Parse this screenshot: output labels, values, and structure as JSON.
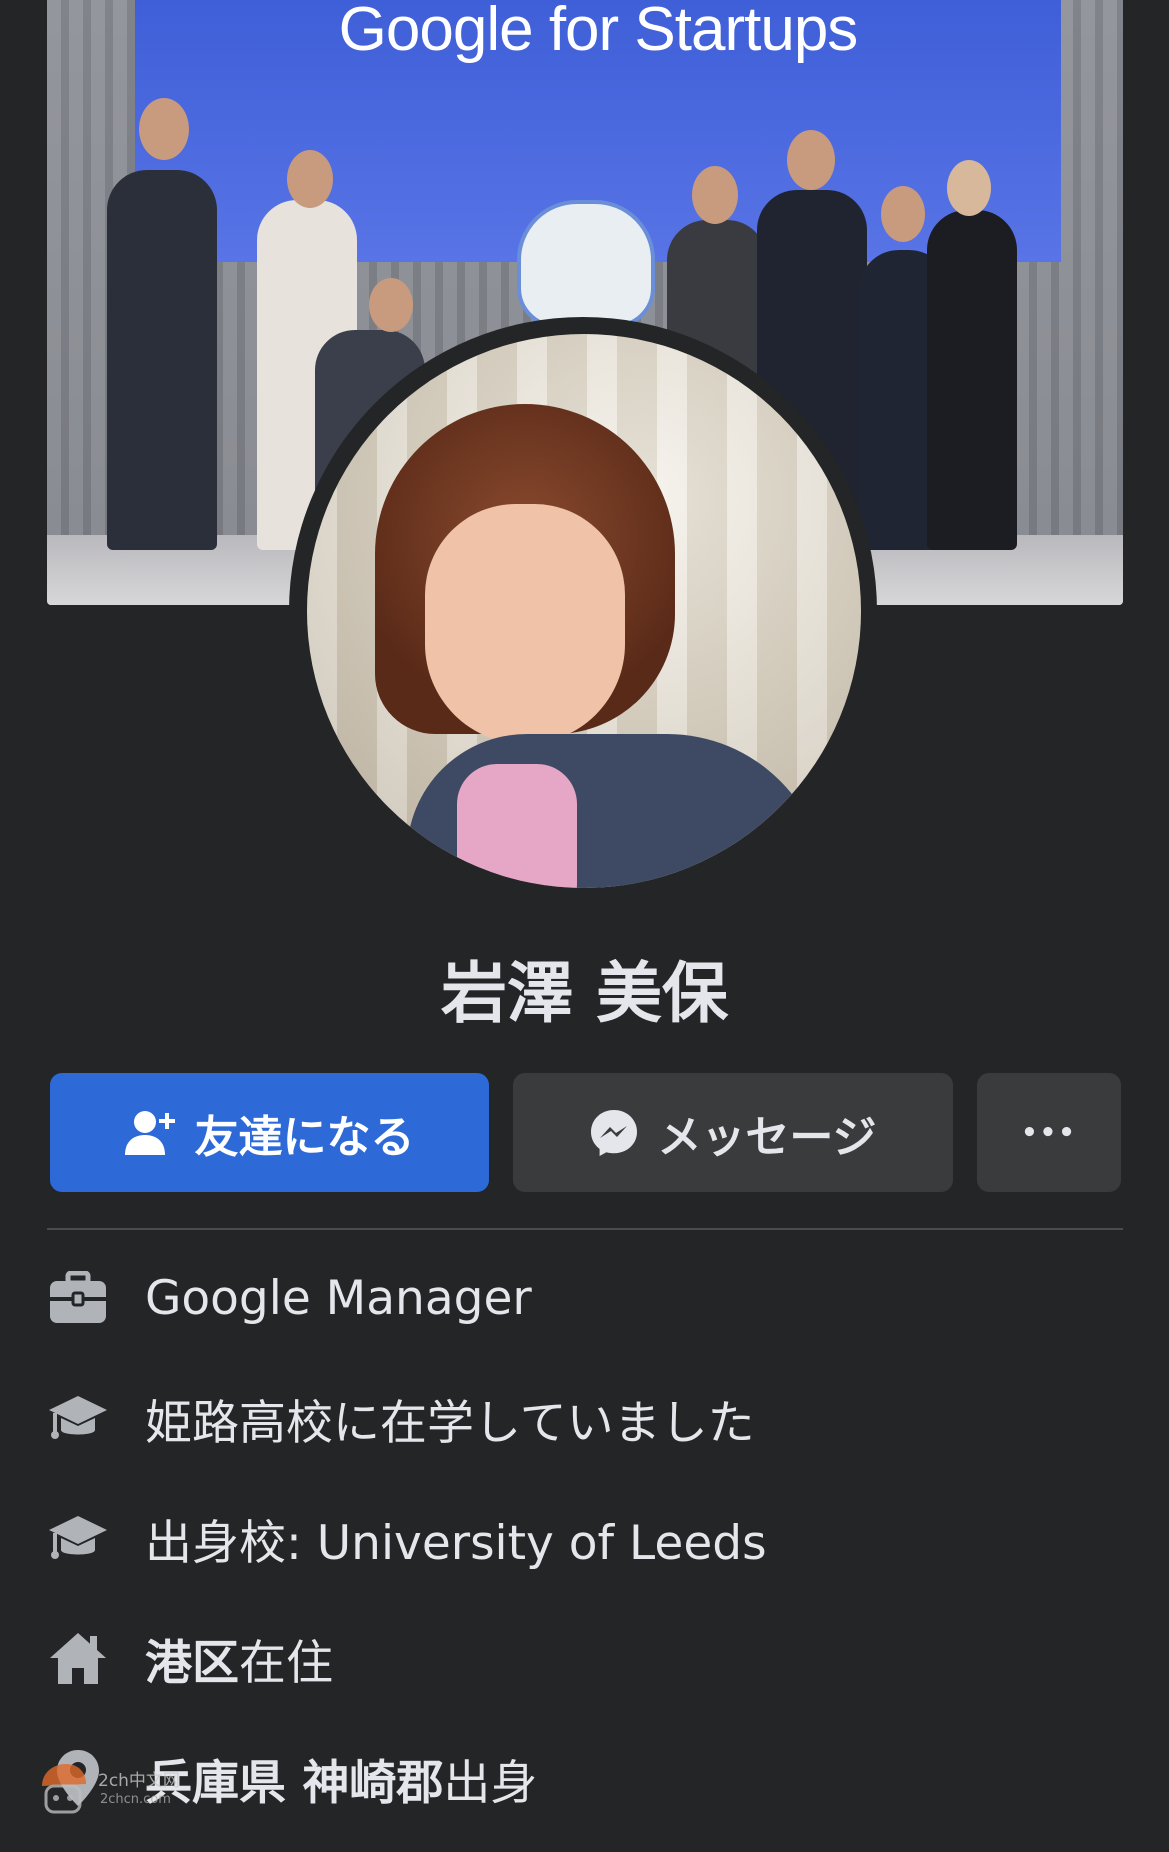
{
  "cover": {
    "screen_title": "Google for Startups"
  },
  "profile": {
    "name": "岩澤 美保"
  },
  "actions": {
    "add_friend_label": "友達になる",
    "message_label": "メッセージ",
    "more_label": "•••"
  },
  "details": {
    "work": "Google Manager",
    "school_current": "姫路高校に在学していました",
    "school_alma": "出身校: University of Leeds",
    "lives_in_place": "港区",
    "lives_in_suffix": "在住",
    "from_place": "兵庫県 神崎郡",
    "from_suffix": "出身"
  },
  "watermark": {
    "text": "2ch中文网",
    "sub": "2chcn.com"
  },
  "colors": {
    "background": "#242526",
    "primary_button": "#2d6ad8",
    "secondary_button": "#3a3b3c",
    "text": "#e4e6eb"
  },
  "icons": {
    "add_friend": "person-plus-icon",
    "message": "messenger-icon",
    "work": "briefcase-icon",
    "school": "graduation-cap-icon",
    "home": "house-icon",
    "location": "location-pin-icon"
  }
}
